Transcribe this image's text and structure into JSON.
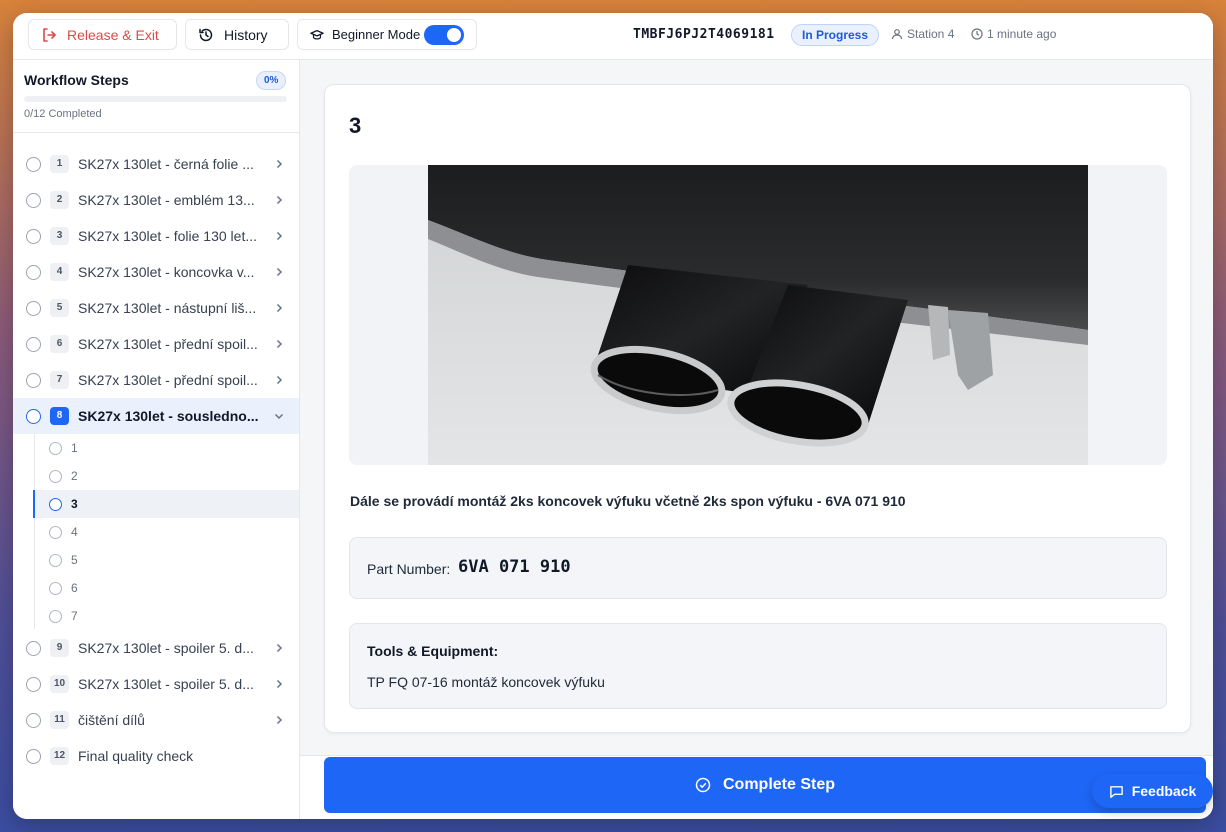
{
  "topbar": {
    "exit_label": "Release & Exit",
    "history_label": "History",
    "beginner_label": "Beginner Mode",
    "beginner_enabled": true,
    "vin": "TMBFJ6PJ2T4069181",
    "status": "In Progress",
    "station": "Station 4",
    "time_ago": "1 minute ago"
  },
  "sidebar": {
    "title": "Workflow Steps",
    "percent": "0%",
    "progress": 0,
    "completed": "0/12 Completed",
    "steps": [
      {
        "num": "1",
        "label": "SK27x 130let - černá folie ..."
      },
      {
        "num": "2",
        "label": "SK27x 130let - emblém 13..."
      },
      {
        "num": "3",
        "label": "SK27x 130let - folie 130 let..."
      },
      {
        "num": "4",
        "label": "SK27x 130let - koncovka v..."
      },
      {
        "num": "5",
        "label": "SK27x 130let - nástupní liš..."
      },
      {
        "num": "6",
        "label": "SK27x 130let - přední spoil..."
      },
      {
        "num": "7",
        "label": "SK27x 130let - přední spoil..."
      },
      {
        "num": "8",
        "label": "SK27x 130let - sousledno..."
      },
      {
        "num": "9",
        "label": "SK27x 130let - spoiler 5. d..."
      },
      {
        "num": "10",
        "label": "SK27x 130let - spoiler 5. d..."
      },
      {
        "num": "11",
        "label": "čištění dílů"
      },
      {
        "num": "12",
        "label": "Final quality check"
      }
    ],
    "substeps": [
      "1",
      "2",
      "3",
      "4",
      "5",
      "6",
      "7"
    ]
  },
  "main": {
    "step_title": "3",
    "instruction": "Dále se provádí montáž 2ks koncovek výfuku včetně 2ks spon výfuku - 6VA 071 910",
    "part_label": "Part Number:",
    "part_number": "6VA 071 910",
    "tools_title": "Tools & Equipment:",
    "tools_item": "TP FQ 07-16 montáž koncovek výfuku",
    "complete_label": "Complete Step"
  },
  "feedback_label": "Feedback",
  "colors": {
    "accent": "#1e66f5",
    "danger": "#e04848"
  }
}
